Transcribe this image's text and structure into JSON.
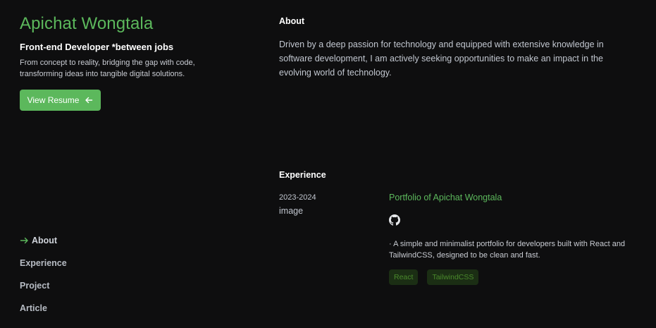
{
  "profile": {
    "name": "Apichat Wongtala",
    "role": "Front-end Developer *between jobs",
    "tagline": "From concept to reality, bridging the gap with code, transforming ideas into tangible digital solutions.",
    "resume_label": "View Resume"
  },
  "nav": {
    "items": [
      {
        "label": "About",
        "active": true
      },
      {
        "label": "Experience",
        "active": false
      },
      {
        "label": "Project",
        "active": false
      },
      {
        "label": "Article",
        "active": false
      }
    ]
  },
  "about": {
    "title": "About",
    "text": "Driven by a deep passion for technology and equipped with extensive knowledge in software development, I am actively seeking opportunities to make an impact in the evolving world of technology."
  },
  "experience": {
    "title": "Experience",
    "items": [
      {
        "date": "2023-2024",
        "image": "image",
        "title": "Portfolio of Apichat Wongtala",
        "icon": "github-icon",
        "description": "· A simple and minimalist portfolio for developers built with React and TailwindCSS, designed to be clean and fast.",
        "tags": [
          "React",
          "TailwindCSS"
        ]
      }
    ]
  },
  "colors": {
    "accent": "#5cb85c",
    "background": "#0e0e0f",
    "tag_bg": "#1b2e14",
    "tag_text": "#4a8a2c"
  }
}
